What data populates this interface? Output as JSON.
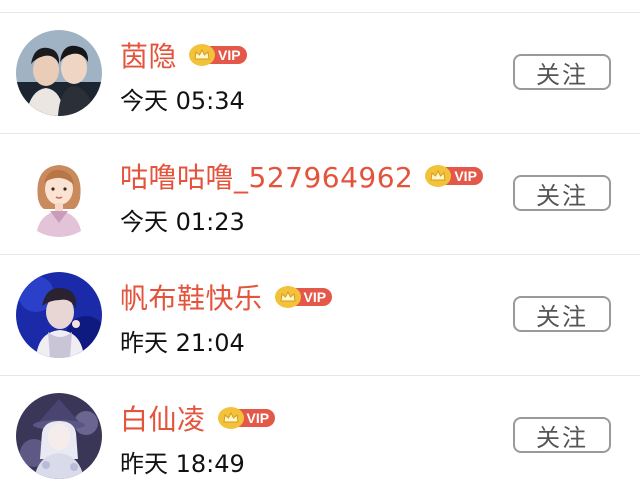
{
  "follower_list": [
    {
      "name": "茵隐",
      "vip_label": "VIP",
      "show_vip": true,
      "time": "今天 05:34",
      "follow_label": "关注",
      "avatar_icon": "avatar-two-men-photo"
    },
    {
      "name": "咕噜咕噜_527964962",
      "vip_label": "VIP",
      "show_vip": true,
      "time": "今天 01:23",
      "follow_label": "关注",
      "avatar_icon": "avatar-cartoon-girl"
    },
    {
      "name": "帆布鞋快乐",
      "vip_label": "VIP",
      "show_vip": true,
      "time": "昨天 21:04",
      "follow_label": "关注",
      "avatar_icon": "avatar-singer-photo"
    },
    {
      "name": "白仙凌",
      "vip_label": "VIP",
      "show_vip": true,
      "time": "昨天 18:49",
      "follow_label": "关注",
      "avatar_icon": "avatar-anime-character"
    }
  ],
  "colors": {
    "name": "#e4533b",
    "vip_tag": "#e4584a",
    "crown": "#f3c23b",
    "button_border": "#9a9a9a",
    "divider": "#e6e6e6"
  }
}
